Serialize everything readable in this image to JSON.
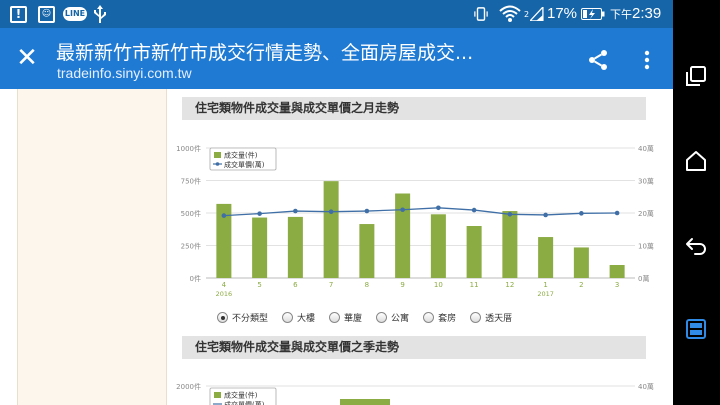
{
  "status": {
    "battery_percent": "17%",
    "time_prefix": "下午",
    "time": "2:39",
    "line_badge": "LINE",
    "signal_label": "2"
  },
  "appbar": {
    "title": "最新新竹市新竹市成交行情走勢、全面房屋成交...",
    "url": "tradeinfo.sinyi.com.tw"
  },
  "sections": {
    "monthly_title": "住宅類物件成交量與成交單價之月走勢",
    "quarterly_title": "住宅類物件成交量與成交單價之季走勢"
  },
  "filters": [
    {
      "label": "不分類型",
      "selected": true
    },
    {
      "label": "大樓",
      "selected": false
    },
    {
      "label": "華廈",
      "selected": false
    },
    {
      "label": "公寓",
      "selected": false
    },
    {
      "label": "套房",
      "selected": false
    },
    {
      "label": "透天厝",
      "selected": false
    }
  ],
  "colors": {
    "status_bar": "#1565a8",
    "app_bar": "#1f7ad4",
    "bar": "#8bab43",
    "line": "#3f6fa6"
  },
  "chart_data": [
    {
      "type": "bar",
      "categories": [
        "4",
        "5",
        "6",
        "7",
        "8",
        "9",
        "10",
        "11",
        "12",
        "1",
        "2",
        "3"
      ],
      "year_labels": [
        {
          "at": "4",
          "label": "2016"
        },
        {
          "at": "1",
          "label": "2017"
        }
      ],
      "series": [
        {
          "name": "成交量(件)",
          "type": "bar",
          "axis": "left",
          "values": [
            570,
            465,
            470,
            745,
            415,
            650,
            490,
            400,
            515,
            315,
            235,
            100
          ]
        },
        {
          "name": "成交單價(萬)",
          "type": "line",
          "axis": "right",
          "values": [
            19.2,
            19.8,
            20.6,
            20.4,
            20.6,
            21.0,
            21.6,
            20.9,
            19.6,
            19.4,
            19.9,
            20.0
          ]
        }
      ],
      "left_ticks": [
        "0件",
        "250件",
        "500件",
        "750件",
        "1000件"
      ],
      "right_ticks": [
        "0萬",
        "10萬",
        "20萬",
        "30萬",
        "40萬"
      ],
      "ylim_left": [
        0,
        1000
      ],
      "ylim_right": [
        0,
        40
      ],
      "legend": "top-left",
      "grid": true
    },
    {
      "type": "bar",
      "partial": true,
      "series": [
        {
          "name": "成交量(件)",
          "type": "bar"
        },
        {
          "name": "成交單價(萬)",
          "type": "line"
        }
      ],
      "left_ticks": [
        "2000件"
      ],
      "right_ticks": [
        "40萬"
      ],
      "legend": "top-left"
    }
  ]
}
